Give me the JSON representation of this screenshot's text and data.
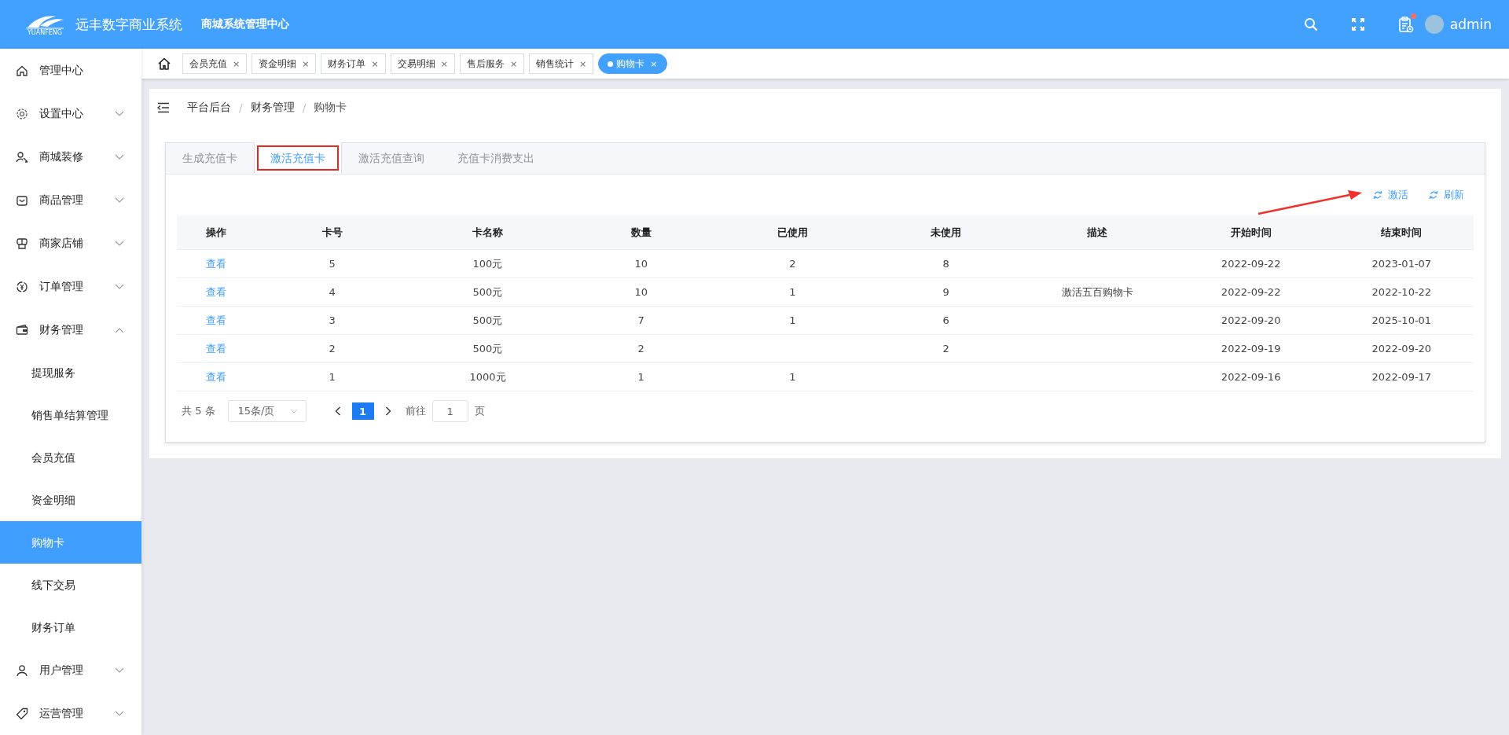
{
  "header": {
    "logo_text": "YUANFENG",
    "title": "远丰数字商业系统",
    "subtitle": "商城系统管理中心",
    "notification": true,
    "user": "admin"
  },
  "tags_bar": {
    "tags": [
      {
        "label": "会员充值",
        "close": "×",
        "selected": false
      },
      {
        "label": "资金明细",
        "close": "×",
        "selected": false
      },
      {
        "label": "财务订单",
        "close": "×",
        "selected": false
      },
      {
        "label": "交易明细",
        "close": "×",
        "selected": false
      },
      {
        "label": "售后服务",
        "close": "×",
        "selected": false
      },
      {
        "label": "销售统计",
        "close": "×",
        "selected": false
      },
      {
        "label": "购物卡",
        "close": "×",
        "selected": true
      }
    ]
  },
  "sidebar": {
    "items": [
      {
        "label": "管理中心",
        "kind": "link",
        "selected": false
      },
      {
        "label": "设置中心",
        "kind": "group",
        "expanded": false,
        "selected": false
      },
      {
        "label": "商城装修",
        "kind": "group",
        "expanded": false,
        "selected": false
      },
      {
        "label": "商品管理",
        "kind": "group",
        "expanded": false,
        "selected": false
      },
      {
        "label": "商家店铺",
        "kind": "group",
        "expanded": false,
        "selected": false
      },
      {
        "label": "订单管理",
        "kind": "group",
        "expanded": false,
        "selected": false
      },
      {
        "label": "财务管理",
        "kind": "group",
        "expanded": true,
        "selected": false,
        "children": [
          {
            "label": "提现服务",
            "selected": false
          },
          {
            "label": "销售单结算管理",
            "selected": false
          },
          {
            "label": "会员充值",
            "selected": false
          },
          {
            "label": "资金明细",
            "selected": false
          },
          {
            "label": "购物卡",
            "selected": true
          },
          {
            "label": "线下交易",
            "selected": false
          },
          {
            "label": "财务订单",
            "selected": false
          }
        ]
      },
      {
        "label": "用户管理",
        "kind": "group",
        "expanded": false,
        "selected": false
      },
      {
        "label": "运营管理",
        "kind": "group",
        "expanded": false,
        "selected": false
      }
    ]
  },
  "breadcrumb": [
    {
      "label": "平台后台",
      "separator": "/"
    },
    {
      "label": "财务管理",
      "separator": "/"
    },
    {
      "label": "购物卡"
    }
  ],
  "tabs": [
    {
      "label": "生成充值卡",
      "selected": false,
      "highlighted": false
    },
    {
      "label": "激活充值卡",
      "selected": true,
      "highlighted": true
    },
    {
      "label": "激活充值查询",
      "selected": false,
      "highlighted": false
    },
    {
      "label": "充值卡消费支出",
      "selected": false,
      "highlighted": false
    }
  ],
  "toolbar": {
    "actions": [
      {
        "label": "激活",
        "arrow": true
      },
      {
        "label": "刷新",
        "arrow": false
      }
    ]
  },
  "table": {
    "columns": [
      "操作",
      "卡号",
      "卡名称",
      "数量",
      "已使用",
      "未使用",
      "描述",
      "开始时间",
      "结束时间"
    ],
    "rows": [
      [
        "查看",
        "5",
        "100元",
        "10",
        "2",
        "8",
        null,
        "2022-09-22",
        "2023-01-07"
      ],
      [
        "查看",
        "4",
        "500元",
        "10",
        "1",
        "9",
        "激活五百购物卡",
        "2022-09-22",
        "2022-10-22"
      ],
      [
        "查看",
        "3",
        "500元",
        "7",
        "1",
        "6",
        null,
        "2022-09-20",
        "2025-10-01"
      ],
      [
        "查看",
        "2",
        "500元",
        "2",
        null,
        "2",
        null,
        "2022-09-19",
        "2022-09-20"
      ],
      [
        "查看",
        "1",
        "1000元",
        "1",
        "1",
        null,
        null,
        "2022-09-16",
        "2022-09-17"
      ]
    ]
  },
  "pagination": {
    "total": "共 5 条",
    "page_size": "15条/页",
    "pages": [
      {
        "label": "1",
        "selected": true
      }
    ],
    "goto_label": "前往",
    "goto_value": "1",
    "goto_suffix": "页"
  }
}
